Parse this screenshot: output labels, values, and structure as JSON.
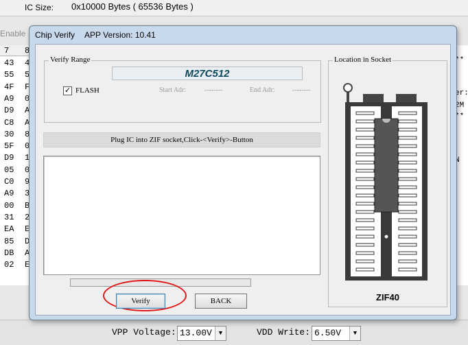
{
  "background": {
    "ic_size_label": "IC Size:",
    "ic_size_value": "0x10000 Bytes ( 65536 Bytes )",
    "enable_label": "Enable",
    "hex_headers": [
      "7",
      "8"
    ],
    "hex_rows": [
      "43",
      "55",
      "4F",
      "A9",
      "D9",
      "C8",
      "30",
      "5F",
      "D9",
      "05",
      "C0",
      "A9",
      "00",
      "31",
      "EA",
      "85",
      "DB",
      "02"
    ],
    "hex_rows_col2": [
      "4",
      "5",
      "F",
      "0",
      "A",
      "A",
      "8",
      "0",
      "1",
      "0",
      "9",
      "3",
      "B",
      "2",
      "E",
      "D",
      "A",
      "E"
    ],
    "right_edge_text": [
      "**",
      "",
      "er:",
      "2M",
      "**",
      "",
      "",
      "N"
    ],
    "vpp_label": "VPP Voltage:",
    "vpp_value": "13.00V",
    "vdd_label": "VDD Write:",
    "vdd_value": "6.50V"
  },
  "dialog": {
    "title": "Chip Verify",
    "version": "APP Version: 10.41",
    "verify_range_title": "Verify Range",
    "chip_name": "M27C512",
    "flash_checked": true,
    "flash_check_mark": "✓",
    "flash_label": "FLASH",
    "start_adr_label": "Start Adr:",
    "start_adr_value": "--------",
    "end_adr_label": "End Adr:",
    "end_adr_value": "--------",
    "instruction": "Plug IC into ZIF socket,Click-<Verify>-Button",
    "progress_percent": 0,
    "verify_button": "Verify",
    "back_button": "BACK",
    "socket_title": "Location in Socket",
    "socket_label": "ZIF40"
  }
}
